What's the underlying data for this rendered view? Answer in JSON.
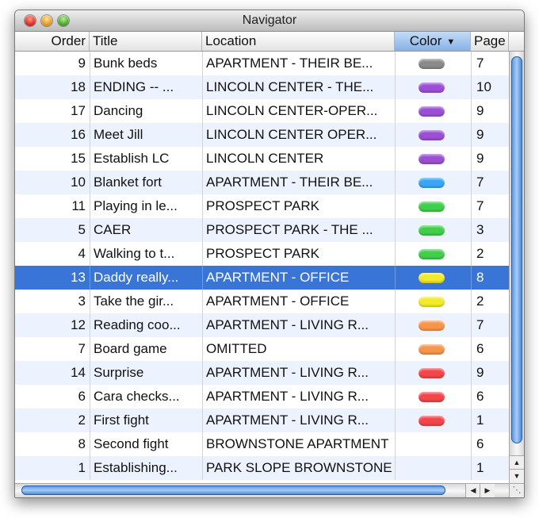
{
  "window": {
    "title": "Navigator"
  },
  "columns": {
    "order": "Order",
    "title": "Title",
    "location": "Location",
    "color": "Color",
    "page": "Page"
  },
  "sort": {
    "column": "color",
    "direction": "descending"
  },
  "colors": {
    "gray": "#8a8a8a",
    "purple": "#9b4fd6",
    "blue": "#39a5f5",
    "green": "#3fcf4a",
    "yellow": "#f2ea2a",
    "orange": "#f7954a",
    "red": "#f2464a",
    "selection": "#3875d7",
    "alt_row": "#edf3fe"
  },
  "rows": [
    {
      "order": "9",
      "title": "Bunk beds",
      "location": "APARTMENT - THEIR BE...",
      "color": "gray",
      "page": "7"
    },
    {
      "order": "18",
      "title": "ENDING -- ...",
      "location": "LINCOLN CENTER - THE...",
      "color": "purple",
      "page": "10"
    },
    {
      "order": "17",
      "title": "Dancing",
      "location": "LINCOLN CENTER-OPER...",
      "color": "purple",
      "page": "9"
    },
    {
      "order": "16",
      "title": "Meet Jill",
      "location": "LINCOLN CENTER OPER...",
      "color": "purple",
      "page": "9"
    },
    {
      "order": "15",
      "title": "Establish LC",
      "location": "LINCOLN CENTER",
      "color": "purple",
      "page": "9"
    },
    {
      "order": "10",
      "title": "Blanket fort",
      "location": "APARTMENT - THEIR BE...",
      "color": "blue",
      "page": "7"
    },
    {
      "order": "11",
      "title": "Playing in le...",
      "location": "PROSPECT PARK",
      "color": "green",
      "page": "7"
    },
    {
      "order": "5",
      "title": "CAER",
      "location": "PROSPECT PARK - THE ...",
      "color": "green",
      "page": "3"
    },
    {
      "order": "4",
      "title": "Walking to t...",
      "location": "PROSPECT PARK",
      "color": "green",
      "page": "2"
    },
    {
      "order": "13",
      "title": "Daddy really...",
      "location": "APARTMENT - OFFICE",
      "color": "yellow",
      "page": "8",
      "selected": true
    },
    {
      "order": "3",
      "title": "Take the gir...",
      "location": "APARTMENT - OFFICE",
      "color": "yellow",
      "page": "2"
    },
    {
      "order": "12",
      "title": "Reading coo...",
      "location": "APARTMENT - LIVING R...",
      "color": "orange",
      "page": "7"
    },
    {
      "order": "7",
      "title": "Board game",
      "location": "OMITTED",
      "color": "orange",
      "page": "6"
    },
    {
      "order": "14",
      "title": "Surprise",
      "location": "APARTMENT - LIVING R...",
      "color": "red",
      "page": "9"
    },
    {
      "order": "6",
      "title": "Cara checks...",
      "location": "APARTMENT - LIVING R...",
      "color": "red",
      "page": "6"
    },
    {
      "order": "2",
      "title": "First fight",
      "location": "APARTMENT - LIVING R...",
      "color": "red",
      "page": "1"
    },
    {
      "order": "8",
      "title": "Second fight",
      "location": "BROWNSTONE APARTMENT",
      "color": null,
      "page": "6"
    },
    {
      "order": "1",
      "title": "Establishing...",
      "location": "PARK SLOPE BROWNSTONE",
      "color": null,
      "page": "1"
    }
  ]
}
